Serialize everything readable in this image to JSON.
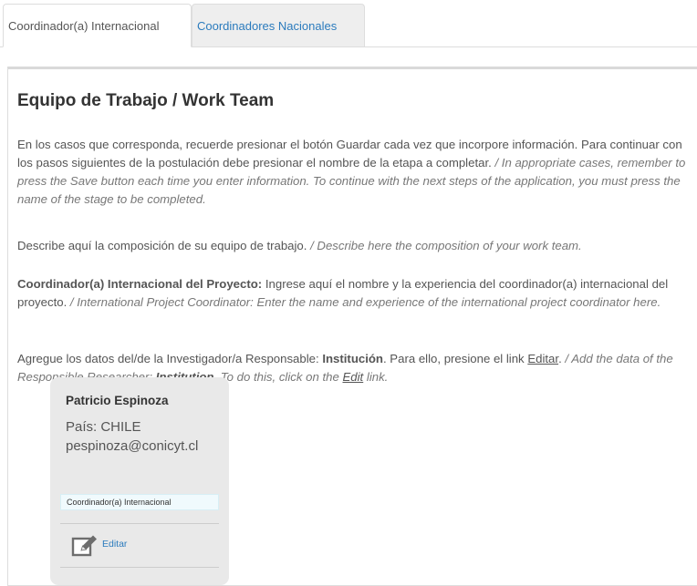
{
  "tabs": [
    {
      "label": "Coordinador(a) Internacional",
      "active": true
    },
    {
      "label": "Coordinadores Nacionales",
      "active": false
    }
  ],
  "section": {
    "title": "Equipo de Trabajo / Work Team",
    "instructions_es": "En los casos que corresponda, recuerde presionar el botón Guardar cada vez que incorpore información. Para continuar con los pasos siguientes de la postulación debe presionar el nombre de la etapa a completar.",
    "instructions_en": "/ In appropriate cases, remember to press the Save button each time you enter information. To continue with the next steps of the application, you must press the name of the stage to be completed.",
    "describe_es": "Describe aquí la composición de su equipo de trabajo.",
    "describe_en": "/ Describe here the composition of your work team.",
    "coordinator_label": "Coordinador(a) Internacional del Proyecto:",
    "coordinator_es": "Ingrese aquí el nombre y la experiencia del coordinador(a) internacional del proyecto.",
    "coordinator_en": "/ International Project Coordinator: Enter the name and experience of the international project coordinator here.",
    "add_es_1": "Agregue los datos del/de la Investigador/a Responsable:",
    "add_es_bold": "Institución",
    "add_es_2": ". Para ello, presione el link",
    "add_es_link": "Editar",
    "add_es_3": ".",
    "add_en_1": "/ Add the data of the Responsible Researcher:",
    "add_en_bold": "Institution",
    "add_en_2": ". To do this, click on the",
    "add_en_link": "Edit",
    "add_en_3": "link."
  },
  "card": {
    "name": "Patricio Espinoza",
    "country": "País: CHILE",
    "email": "pespinoza@conicyt.cl",
    "role_badge": "Coordinador(a) Internacional",
    "edit_label": "Editar",
    "edit_icon": "edit-icon"
  },
  "colors": {
    "link": "#2b7bbd",
    "card_bg": "#e9e9e9",
    "badge_bg": "#f0fafd"
  }
}
